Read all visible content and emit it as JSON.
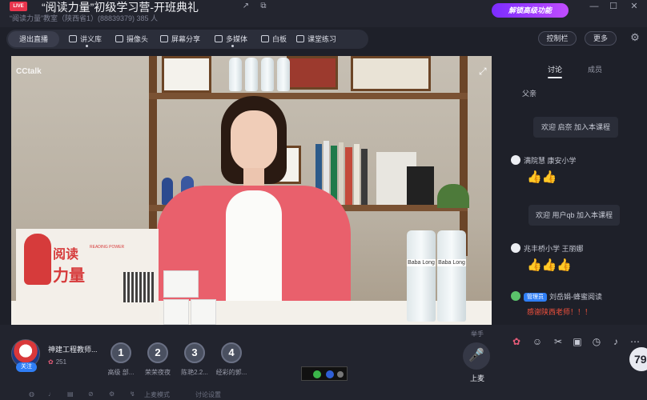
{
  "titlebar": {
    "live_badge": "LIVE",
    "course_title": "“阅读力量”初级学习营-开班典礼",
    "course_meta": "“阅读力量”教室（陕西省1）(88839379)   385 人",
    "promo_label": "解锁高级功能",
    "icons": [
      "share-icon",
      "copy-icon",
      "minimize-icon",
      "maximize-icon",
      "close-icon"
    ]
  },
  "toolbar": {
    "exit_label": "退出直播",
    "tools": [
      {
        "name": "lecture-library",
        "label": "讲义库",
        "icon": "document-icon"
      },
      {
        "name": "camera",
        "label": "摄像头",
        "icon": "camera-icon"
      },
      {
        "name": "screen-share",
        "label": "屏幕分享",
        "icon": "screen-icon"
      },
      {
        "name": "multimedia",
        "label": "多媒体",
        "icon": "play-icon"
      },
      {
        "name": "whiteboard",
        "label": "白板",
        "icon": "board-icon"
      },
      {
        "name": "classroom-exercise",
        "label": "课堂练习",
        "icon": "pencil-icon"
      }
    ],
    "right_buttons": [
      {
        "label": "控制栏"
      },
      {
        "label": "更多"
      }
    ]
  },
  "video": {
    "watermark": "CCtalk",
    "logo_title_1": "阅读",
    "logo_title_2": "力量",
    "logo_sub": "READING POWER",
    "bottle_label": "Baba Long"
  },
  "chat": {
    "tabs": [
      {
        "label": "讨论",
        "active": true
      },
      {
        "label": "成员",
        "active": false
      }
    ],
    "top_partial": "父亲",
    "messages": [
      {
        "type": "system",
        "text": "欢迎 启奈 加入本课程"
      },
      {
        "type": "user",
        "user": "满院慧 康安小学",
        "text": "👍👍"
      },
      {
        "type": "system",
        "text": "欢迎 用户qb 加入本课程"
      },
      {
        "type": "user",
        "user": "兆丰桥小学 王丽娜",
        "text": "👍👍👍"
      },
      {
        "type": "user",
        "role": "管理员",
        "user": "刘岳娟-蜂蜜阅读",
        "text": "感谢陕西老师！！！"
      }
    ]
  },
  "bottom": {
    "teacher_name": "神建工程教师...",
    "follow_label": "关注",
    "flower_count": "251",
    "ranks": [
      {
        "num": "1",
        "name": "高级 部..."
      },
      {
        "num": "2",
        "name": "荣荣夜夜"
      },
      {
        "num": "3",
        "name": "陈艳2.2..."
      },
      {
        "num": "4",
        "name": "经彩的郭..."
      }
    ],
    "hand_label": "举手",
    "hand_text": "上麦",
    "mini_labels": {
      "left": "上麦模式",
      "right": "讨论设置"
    },
    "chat_tools": [
      "flower-icon",
      "emoji-icon",
      "scissors-icon",
      "image-icon",
      "clock-icon",
      "bell-icon",
      "more-icon"
    ],
    "online_count": "79"
  },
  "colors": {
    "background": "#1e2029",
    "accent_blue": "#2f7ef5",
    "live_red": "#e8344c",
    "promo_purple": "#7b2cff"
  }
}
